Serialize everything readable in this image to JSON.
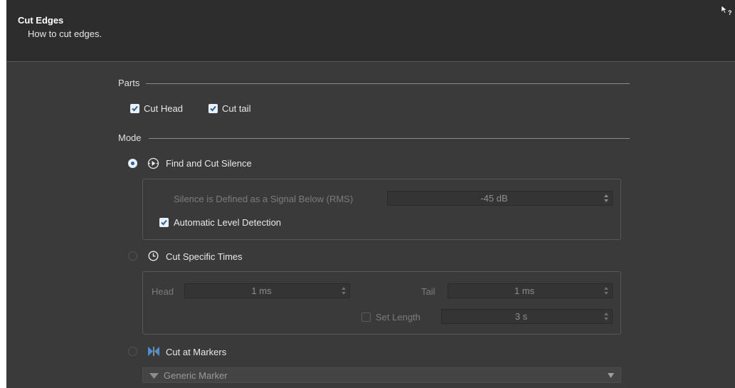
{
  "header": {
    "title": "Cut Edges",
    "subtitle": "How to cut edges."
  },
  "parts": {
    "label": "Parts",
    "cut_head": {
      "label": "Cut Head",
      "checked": true
    },
    "cut_tail": {
      "label": "Cut tail",
      "checked": true
    }
  },
  "mode": {
    "label": "Mode",
    "find_cut_silence": {
      "label": "Find and Cut Silence",
      "selected": true,
      "silence_label": "Silence is Defined as a Signal Below (RMS)",
      "silence_value": "-45 dB",
      "auto_level": {
        "label": "Automatic Level Detection",
        "checked": true
      }
    },
    "cut_specific_times": {
      "label": "Cut Specific Times",
      "selected": false,
      "head_label": "Head",
      "head_value": "1 ms",
      "tail_label": "Tail",
      "tail_value": "1 ms",
      "set_length": {
        "label": "Set Length",
        "checked": false
      },
      "length_value": "3 s"
    },
    "cut_at_markers": {
      "label": "Cut at Markers",
      "selected": false,
      "marker_type": "Generic Marker"
    }
  },
  "icons": {
    "help": "whats-this-help-icon",
    "silence": "find-silence-icon",
    "clock": "clock-icon",
    "markers": "markers-icon",
    "marker_type": "generic-marker-icon",
    "dropdown_arrow": "dropdown-arrow-icon"
  },
  "colors": {
    "panel_bg": "#3a3a3a",
    "header_bg": "#2d2d2d",
    "accent": "#2b5f9e",
    "marker_blue": "#4a90d9"
  }
}
